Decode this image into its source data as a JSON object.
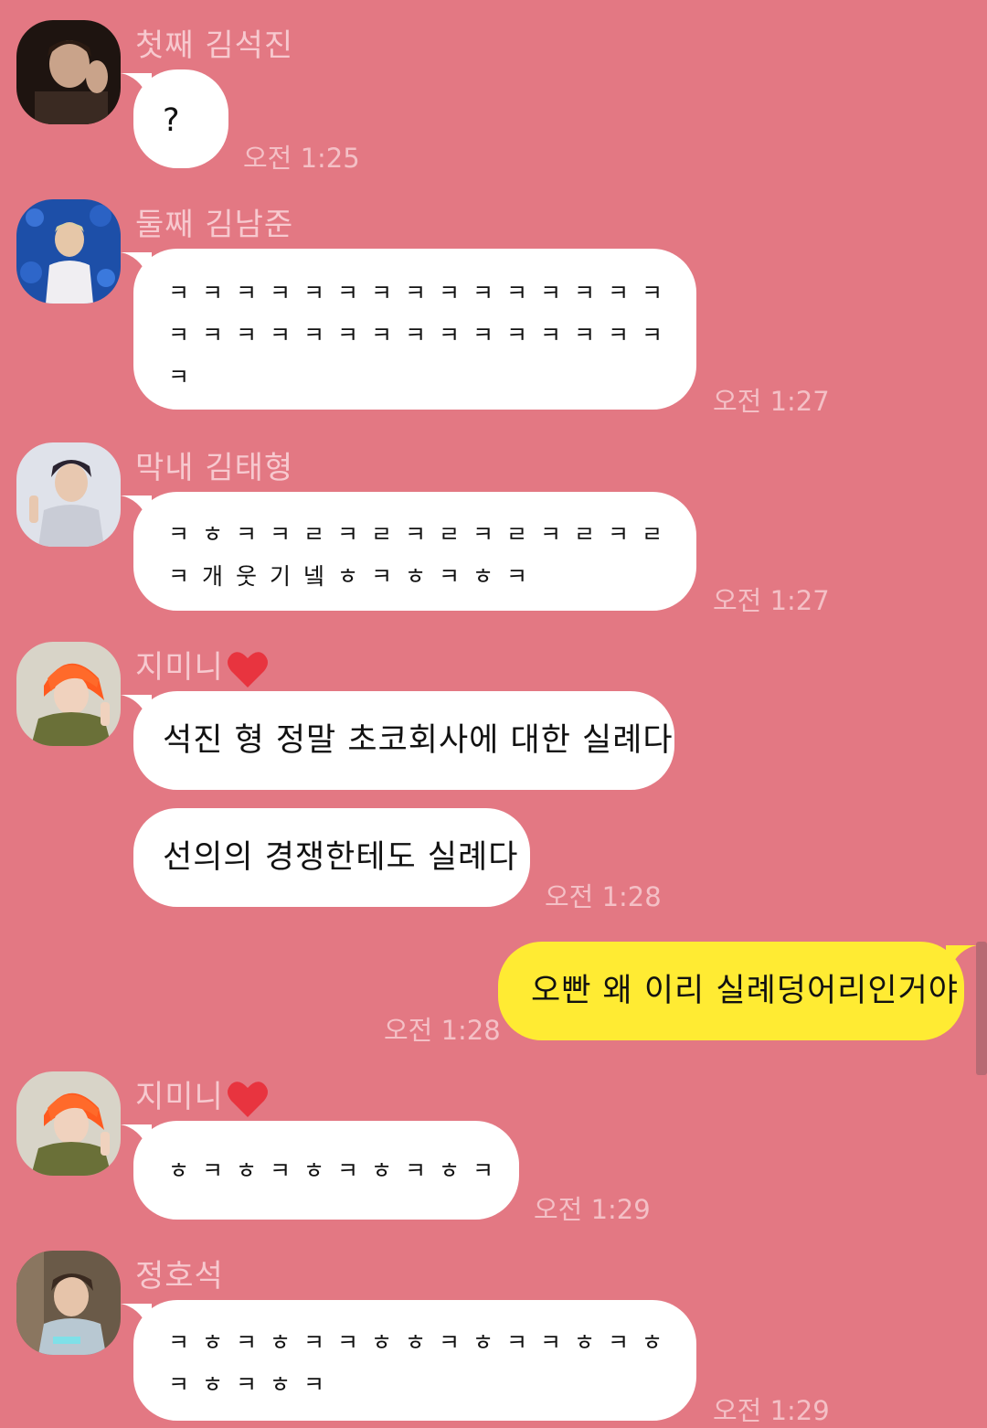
{
  "colors": {
    "background": "#e37883",
    "bubble_other": "#ffffff",
    "bubble_me": "#ffeb33",
    "sender_name": "#f7c9cf",
    "timestamp": "#f4c0c6"
  },
  "messages": [
    {
      "sender": "첫째 김석진",
      "text": "?",
      "time": "오전 1:25"
    },
    {
      "sender": "둘째 김남준",
      "text": "ㅋㅋㅋㅋㅋㅋㅋㅋㅋㅋㅋㅋㅋㅋㅋ\nㅋㅋㅋㅋㅋㅋㅋㅋㅋㅋㅋㅋㅋㅋㅋ\nㅋ",
      "time": "오전 1:27"
    },
    {
      "sender": "막내 김태형",
      "text": "ㅋㅎㅋㅋㄹㅋㄹㅋㄹㅋㄹㅋㄹㅋㄹ\nㅋ개웃기넼ㅎㅋㅎㅋㅎㅋ",
      "time": "오전 1:27"
    },
    {
      "sender": "지미니",
      "sender_icon": "heart-icon",
      "text": "석진 형 정말 초코회사에 대한 실례다"
    },
    {
      "text": "선의의 경쟁한테도 실례다",
      "time": "오전 1:28"
    },
    {
      "mine": true,
      "text": "오빤 왜 이리 실례덩어리인거야",
      "time": "오전 1:28"
    },
    {
      "sender": "지미니",
      "sender_icon": "heart-icon",
      "text": "ㅎㅋㅎㅋㅎㅋㅎㅋㅎㅋ",
      "time": "오전 1:29"
    },
    {
      "sender": "정호석",
      "text": "ㅋㅎㅋㅎㅋㅋㅎㅎㅋㅎㅋㅋㅎㅋㅎ\nㅋㅎㅋㅎㅋ",
      "time": "오전 1:29"
    }
  ]
}
